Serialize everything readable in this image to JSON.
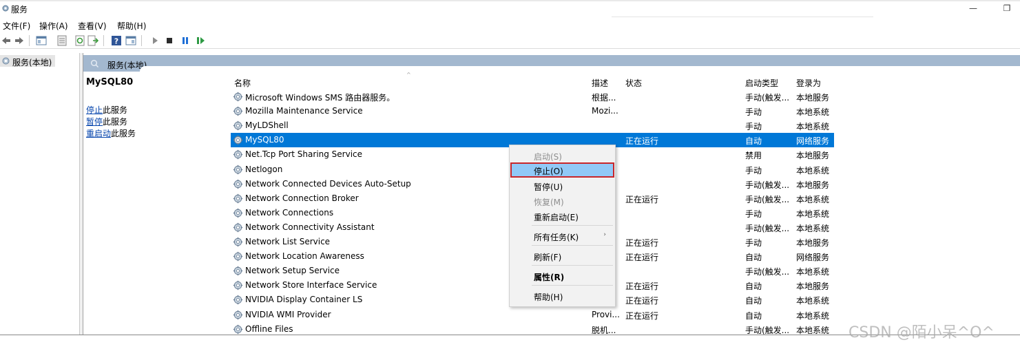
{
  "window": {
    "title": "服务",
    "minimize_glyph": "—",
    "restore_glyph": "❐"
  },
  "menu": [
    "文件(F)",
    "操作(A)",
    "查看(V)",
    "帮助(H)"
  ],
  "toolbar_icons": [
    "back-icon",
    "forward-icon",
    "show-hide-tree-icon",
    "properties-icon",
    "refresh-icon",
    "export-list-icon",
    "help-icon",
    "show-hide-action-pane-icon",
    "start-service-icon",
    "stop-service-icon",
    "pause-service-icon",
    "restart-service-icon"
  ],
  "tree": {
    "item": "服务(本地)"
  },
  "banner": {
    "label": "服务(本地)"
  },
  "detail": {
    "service_name": "MySQL80",
    "actions": [
      {
        "link": "停止",
        "rest": "此服务"
      },
      {
        "link": "暂停",
        "rest": "此服务"
      },
      {
        "link": "重启动",
        "rest": "此服务"
      }
    ]
  },
  "columns": {
    "name": "名称",
    "desc": "描述",
    "status": "状态",
    "startup": "启动类型",
    "logon": "登录为"
  },
  "services": [
    {
      "name": "Microsoft Windows SMS 路由器服务。",
      "desc": "根据...",
      "status": "",
      "startup": "手动(触发...",
      "logon": "本地服务"
    },
    {
      "name": "Mozilla Maintenance Service",
      "desc": "Mozi...",
      "status": "",
      "startup": "手动",
      "logon": "本地系统"
    },
    {
      "name": "MyLDShell",
      "desc": "",
      "status": "",
      "startup": "手动",
      "logon": "本地系统"
    },
    {
      "name": "MySQL80",
      "desc": "",
      "status": "正在运行",
      "startup": "自动",
      "logon": "网络服务",
      "selected": true
    },
    {
      "name": "Net.Tcp Port Sharing Service",
      "desc": "",
      "status": "",
      "startup": "禁用",
      "logon": "本地服务"
    },
    {
      "name": "Netlogon",
      "desc": "",
      "status": "",
      "startup": "手动",
      "logon": "本地系统"
    },
    {
      "name": "Network Connected Devices Auto-Setup",
      "desc": "",
      "status": "",
      "startup": "手动(触发...",
      "logon": "本地服务"
    },
    {
      "name": "Network Connection Broker",
      "desc": "",
      "status": "正在运行",
      "startup": "手动(触发...",
      "logon": "本地系统"
    },
    {
      "name": "Network Connections",
      "desc": "",
      "status": "",
      "startup": "手动",
      "logon": "本地系统"
    },
    {
      "name": "Network Connectivity Assistant",
      "desc": "",
      "status": "",
      "startup": "手动(触发...",
      "logon": "本地系统"
    },
    {
      "name": "Network List Service",
      "desc": "",
      "status": "正在运行",
      "startup": "手动",
      "logon": "本地服务"
    },
    {
      "name": "Network Location Awareness",
      "desc": "",
      "status": "正在运行",
      "startup": "自动",
      "logon": "网络服务"
    },
    {
      "name": "Network Setup Service",
      "desc": "",
      "status": "",
      "startup": "手动(触发...",
      "logon": "本地系统"
    },
    {
      "name": "Network Store Interface Service",
      "desc": "",
      "status": "正在运行",
      "startup": "自动",
      "logon": "本地服务"
    },
    {
      "name": "NVIDIA Display Container LS",
      "desc": "",
      "status": "正在运行",
      "startup": "自动",
      "logon": "本地系统"
    },
    {
      "name": "NVIDIA WMI Provider",
      "desc": "Provi...",
      "status": "正在运行",
      "startup": "自动",
      "logon": "本地系统"
    },
    {
      "name": "Offline Files",
      "desc": "脱机...",
      "status": "",
      "startup": "手动(触发...",
      "logon": "本地系统"
    }
  ],
  "context_menu": {
    "start": "启动(S)",
    "stop": "停止(O)",
    "pause": "暂停(U)",
    "resume": "恢复(M)",
    "restart": "重新启动(E)",
    "all_tasks": "所有任务(K)",
    "refresh": "刷新(F)",
    "properties": "属性(R)",
    "help": "帮助(H)"
  },
  "watermark": "CSDN @陌小呆^O^",
  "colors": {
    "selection": "#0078d7",
    "banner": "#a3b8cf",
    "menu_highlight": "#91c9f7",
    "highlight_border": "#c8262a",
    "link": "#0645ad"
  }
}
